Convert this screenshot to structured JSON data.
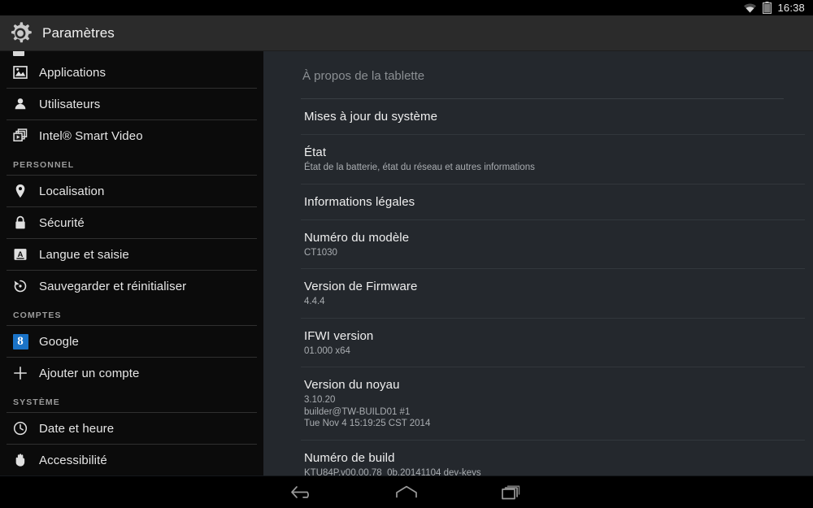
{
  "status_bar": {
    "wifi_icon": "wifi-icon",
    "battery_icon": "battery-icon",
    "clock": "16:38"
  },
  "action_bar": {
    "app_icon": "settings-gear-icon",
    "title": "Paramètres"
  },
  "sidebar": {
    "items": [
      {
        "label": "Applications",
        "icon": "applications-icon",
        "type": "item",
        "selected": false
      },
      {
        "label": "Utilisateurs",
        "icon": "user-icon",
        "type": "item",
        "selected": false
      },
      {
        "label": "Intel® Smart Video",
        "icon": "video-windows-icon",
        "type": "item",
        "selected": false
      },
      {
        "label": "PERSONNEL",
        "icon": "",
        "type": "header",
        "selected": false
      },
      {
        "label": "Localisation",
        "icon": "location-pin-icon",
        "type": "item",
        "selected": false
      },
      {
        "label": "Sécurité",
        "icon": "lock-icon",
        "type": "item",
        "selected": false
      },
      {
        "label": "Langue et saisie",
        "icon": "keyboard-a-icon",
        "type": "item",
        "selected": false
      },
      {
        "label": "Sauvegarder et réinitialiser",
        "icon": "backup-restore-icon",
        "type": "item",
        "selected": false
      },
      {
        "label": "COMPTES",
        "icon": "",
        "type": "header",
        "selected": false
      },
      {
        "label": "Google",
        "icon": "google-icon",
        "type": "item",
        "selected": false
      },
      {
        "label": "Ajouter un compte",
        "icon": "plus-icon",
        "type": "item",
        "selected": false
      },
      {
        "label": "SYSTÈME",
        "icon": "",
        "type": "header",
        "selected": false
      },
      {
        "label": "Date et heure",
        "icon": "clock-icon",
        "type": "item",
        "selected": false
      },
      {
        "label": "Accessibilité",
        "icon": "hand-icon",
        "type": "item",
        "selected": false
      },
      {
        "label": "À propos de la tablette",
        "icon": "info-circle-icon",
        "type": "item",
        "selected": true
      }
    ]
  },
  "detail": {
    "header": "À propos de la tablette",
    "preferences": [
      {
        "title": "Mises à jour du système",
        "summary": ""
      },
      {
        "title": "État",
        "summary": "État de la batterie, état du réseau et autres informations"
      },
      {
        "title": "Informations légales",
        "summary": ""
      },
      {
        "title": "Numéro du modèle",
        "summary": "CT1030"
      },
      {
        "title": "Version de Firmware",
        "summary": "4.4.4"
      },
      {
        "title": "IFWI version",
        "summary": "01.000 x64"
      },
      {
        "title": "Version du noyau",
        "summary": "3.10.20\nbuilder@TW-BUILD01 #1\nTue Nov 4 15:19:25 CST 2014"
      },
      {
        "title": "Numéro de build",
        "summary": "KTU84P.v00.00.78_0b.20141104 dev-keys"
      }
    ]
  },
  "nav_bar": {
    "buttons": [
      {
        "name": "back-icon",
        "label": "Retour"
      },
      {
        "name": "home-icon",
        "label": "Accueil"
      },
      {
        "name": "recents-icon",
        "label": "Applications récentes"
      }
    ]
  },
  "colors": {
    "accent": "#0c8cb8",
    "sidebar_bg": "#0b0b0b",
    "detail_bg": "#24282d",
    "action_bar_bg": "#2b2b2b"
  }
}
